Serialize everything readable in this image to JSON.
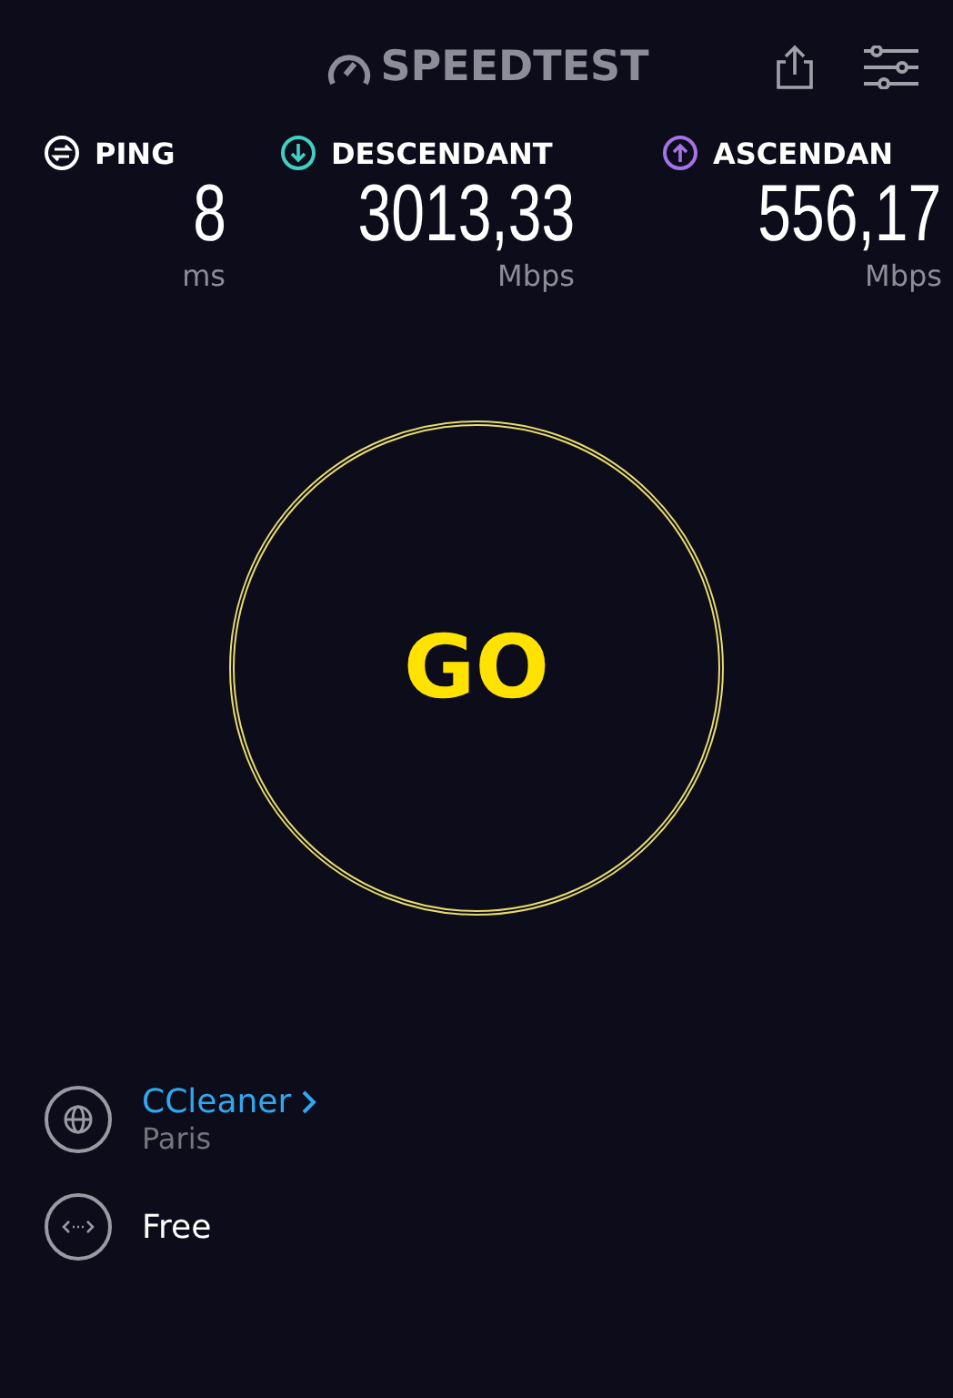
{
  "header": {
    "logo": "SPEEDTEST"
  },
  "metrics": [
    {
      "kind": "ping",
      "label": "PING",
      "value": "8",
      "unit": "ms",
      "color": "#ffffff"
    },
    {
      "kind": "download",
      "label": "DESCENDANT",
      "value": "3013,33",
      "unit": "Mbps",
      "color": "#3fd0c4"
    },
    {
      "kind": "upload",
      "label": "ASCENDAN",
      "value": "556,17",
      "unit": "Mbps",
      "color": "#a673e6"
    }
  ],
  "go_button": {
    "label": "GO"
  },
  "server": {
    "provider": "CCleaner",
    "location": "Paris"
  },
  "connection": {
    "label": "Free"
  }
}
